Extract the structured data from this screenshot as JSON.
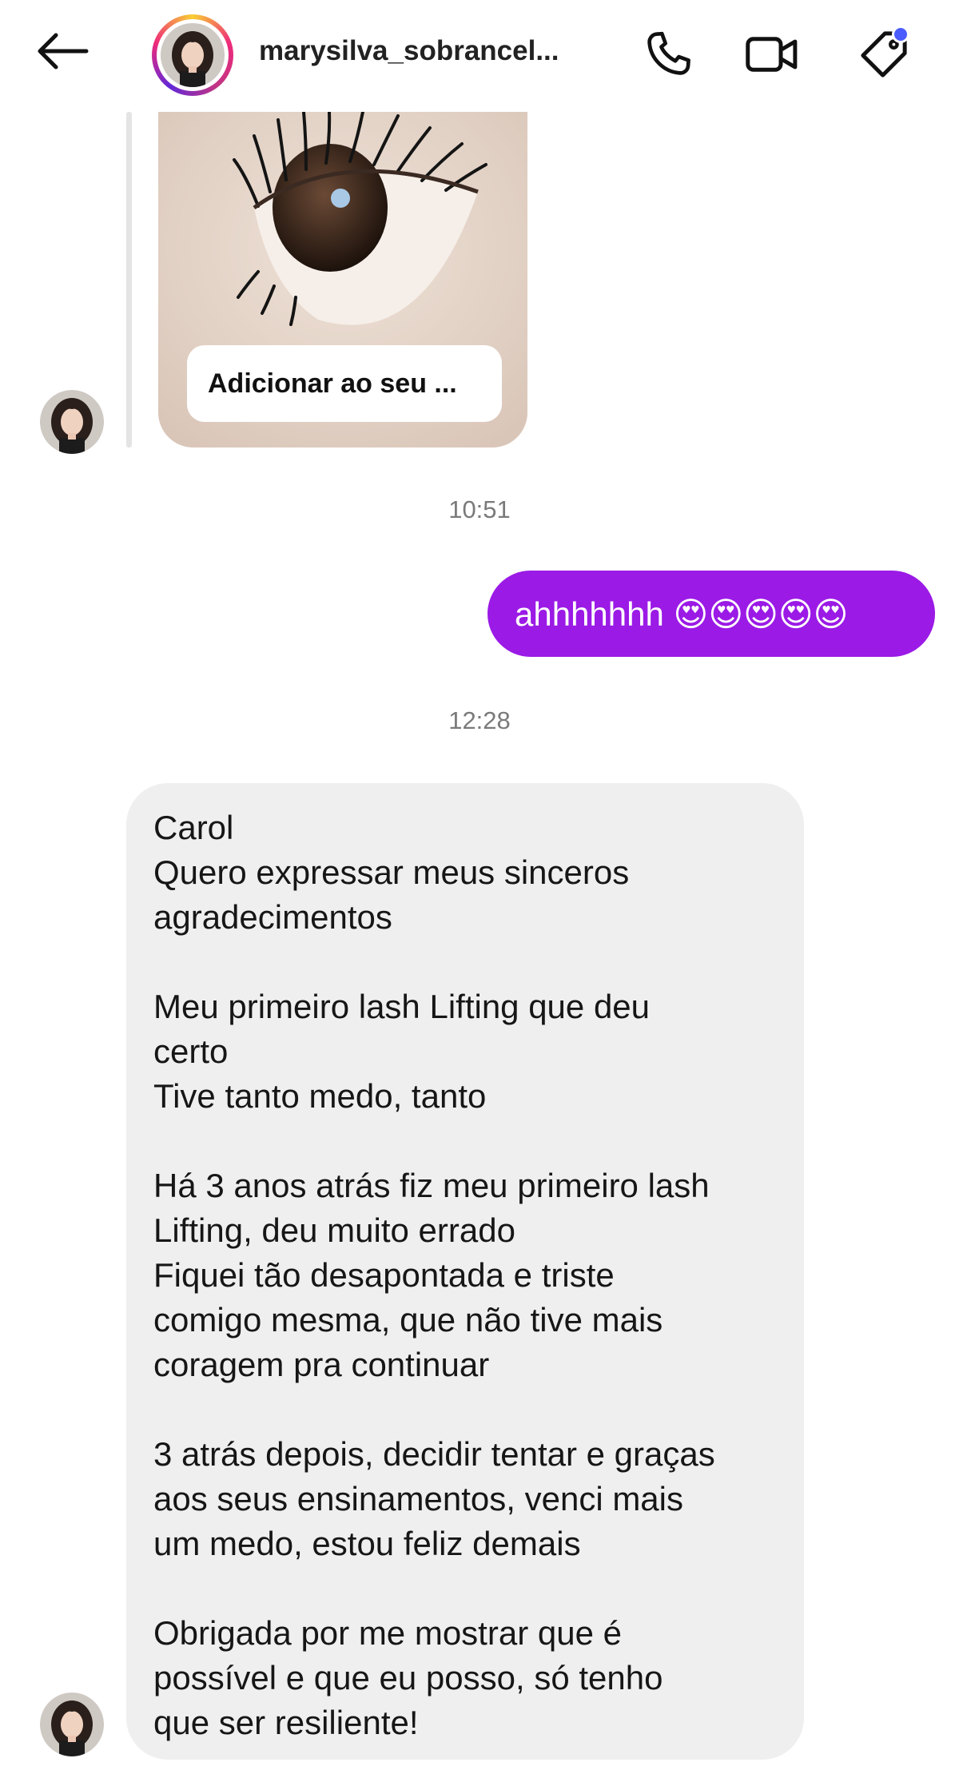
{
  "header": {
    "username": "marysilva_sobrancel...",
    "back_icon": "arrow-left-icon",
    "call_icon": "phone-icon",
    "video_icon": "video-camera-icon",
    "tag_icon": "tag-icon",
    "notification_dot_color": "#4a5cff"
  },
  "shared_post": {
    "button_label": "Adicionar ao seu ..."
  },
  "messages": {
    "time_1": "10:51",
    "sent_text": "ahhhhhhh 😍😍😍😍😍",
    "time_2": "12:28",
    "received_lines": [
      "Carol",
      "Quero expressar meus sinceros",
      "agradecimentos",
      "",
      "Meu primeiro lash Lifting que deu",
      "certo",
      "Tive tanto medo, tanto",
      "",
      "Há 3 anos atrás fiz meu primeiro lash",
      "Lifting, deu muito errado",
      "Fiquei tão desapontada e triste",
      "comigo mesma, que não tive mais",
      "coragem pra continuar",
      "",
      "3 atrás depois, decidir tentar e graças",
      "aos seus ensinamentos, venci mais",
      "um medo, estou feliz demais",
      "",
      "Obrigada por me mostrar que é",
      "possível e que eu posso, só tenho",
      "que ser resiliente!"
    ]
  },
  "colors": {
    "sent_bubble": "#9b1ae6",
    "received_bubble": "#efefef",
    "timestamp": "#7a7a7a"
  }
}
